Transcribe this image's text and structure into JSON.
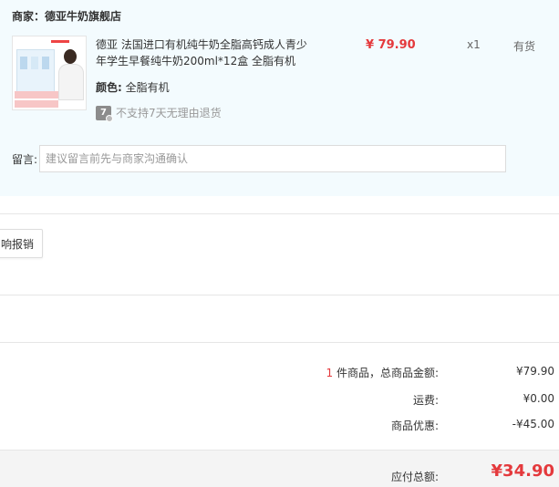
{
  "shop": {
    "label": "商家：德亚牛奶旗舰店"
  },
  "product": {
    "title": "德亚 法国进口有机纯牛奶全脂高钙成人青少年学生早餐纯牛奶200ml*12盒 全脂有机",
    "price": "¥ 79.90",
    "quantity": "x1",
    "stock": "有货",
    "color_label": "颜色:",
    "color_value": "全脂有机",
    "return_icon_text": "7",
    "return_policy": "不支持7天无理由退货",
    "thumb_tag1": "德亚有机",
    "thumb_tag2": "全脂有机"
  },
  "message": {
    "label": "留言:",
    "placeholder": "建议留言前先与商家沟通确认"
  },
  "actions": {
    "report_label": "响报销"
  },
  "summary": {
    "item_count": "1",
    "items_total_label": "件商品，总商品金额:",
    "items_total_value": "¥79.90",
    "shipping_label": "运费:",
    "shipping_value": "¥0.00",
    "discount_label": "商品优惠:",
    "discount_value": "-¥45.00",
    "payable_label": "应付总额:",
    "payable_value": "¥34.90"
  },
  "colors": {
    "accent_red": "#e4393c",
    "shop_bg": "#f3fbfe",
    "total_bg": "#f4f4f4"
  },
  "icons": {
    "return_policy": "no-7-day-return-icon"
  }
}
